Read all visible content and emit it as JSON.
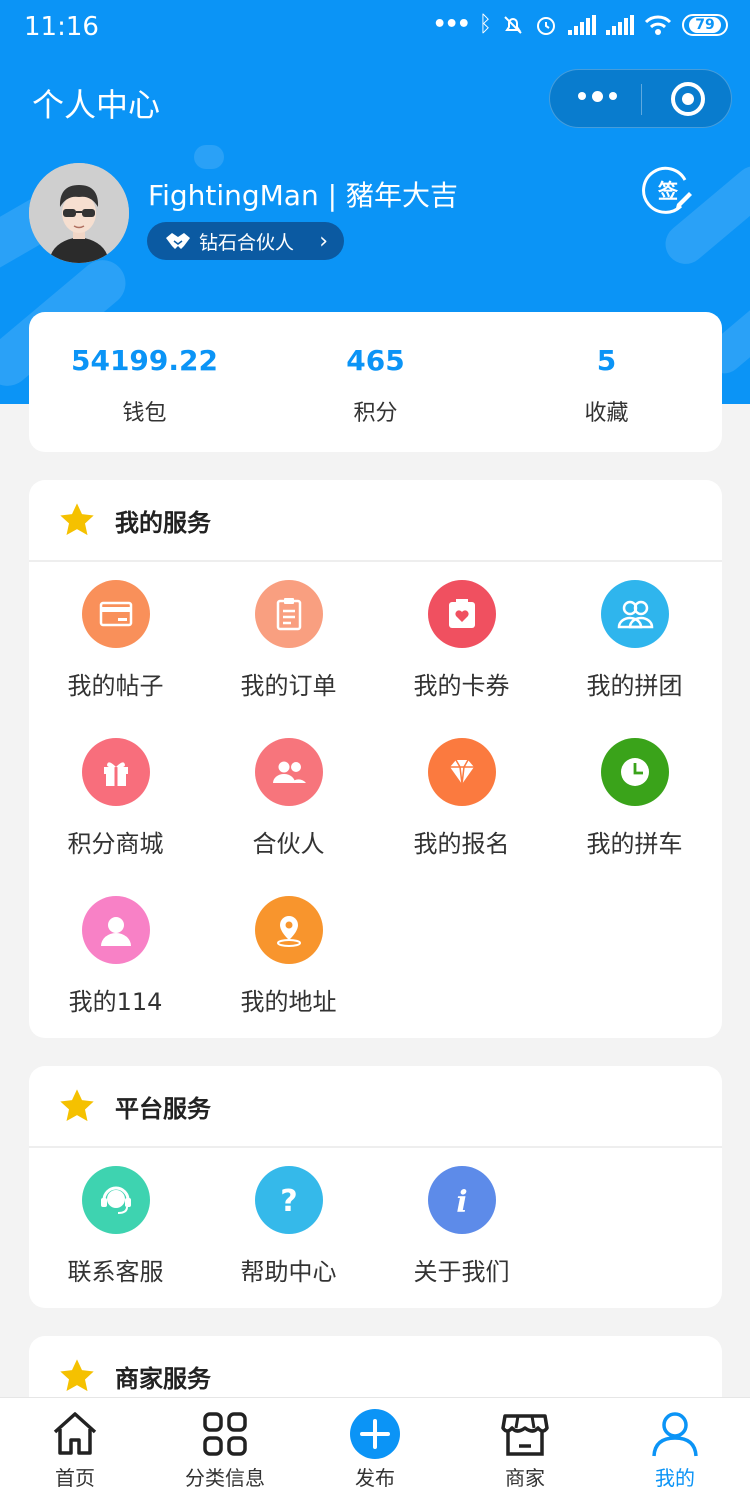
{
  "status_bar": {
    "time": "11:16",
    "battery": "79"
  },
  "header": {
    "title": "个人中心"
  },
  "profile": {
    "name": "FightingMan | 豬年大吉",
    "rank": "钻石合伙人",
    "sign_label": "签"
  },
  "stats": [
    {
      "value": "54199.22",
      "label": "钱包"
    },
    {
      "value": "465",
      "label": "积分"
    },
    {
      "value": "5",
      "label": "收藏"
    }
  ],
  "my_services": {
    "title": "我的服务",
    "items": [
      {
        "label": "我的帖子",
        "icon": "card-icon",
        "color": "#f9905a"
      },
      {
        "label": "我的订单",
        "icon": "clipboard-icon",
        "color": "#f99f80"
      },
      {
        "label": "我的卡券",
        "icon": "coupon-icon",
        "color": "#f05060"
      },
      {
        "label": "我的拼团",
        "icon": "group-icon",
        "color": "#2fb5ed"
      },
      {
        "label": "积分商城",
        "icon": "gift-icon",
        "color": "#f86e7c"
      },
      {
        "label": "合伙人",
        "icon": "partners-icon",
        "color": "#f7757c"
      },
      {
        "label": "我的报名",
        "icon": "diamond-icon",
        "color": "#fb7a3f"
      },
      {
        "label": "我的拼车",
        "icon": "clock-icon",
        "color": "#3aa31a"
      },
      {
        "label": "我的114",
        "icon": "person-icon",
        "color": "#f881c6"
      },
      {
        "label": "我的地址",
        "icon": "location-icon",
        "color": "#f8952d"
      }
    ]
  },
  "platform_services": {
    "title": "平台服务",
    "items": [
      {
        "label": "联系客服",
        "icon": "headset-icon",
        "color": "#3ed3b0"
      },
      {
        "label": "帮助中心",
        "icon": "help-icon",
        "color": "#35b9ea"
      },
      {
        "label": "关于我们",
        "icon": "info-icon",
        "color": "#5d8be9"
      }
    ]
  },
  "merchant_services": {
    "title": "商家服务"
  },
  "tabbar": [
    {
      "label": "首页",
      "icon": "home-icon"
    },
    {
      "label": "分类信息",
      "icon": "grid-icon"
    },
    {
      "label": "发布",
      "icon": "plus-circle-icon"
    },
    {
      "label": "商家",
      "icon": "shop-icon"
    },
    {
      "label": "我的",
      "icon": "user-icon",
      "active": true
    }
  ],
  "colors": {
    "primary": "#0b94f6",
    "star": "#f5c100",
    "background": "#f3f3f3"
  }
}
